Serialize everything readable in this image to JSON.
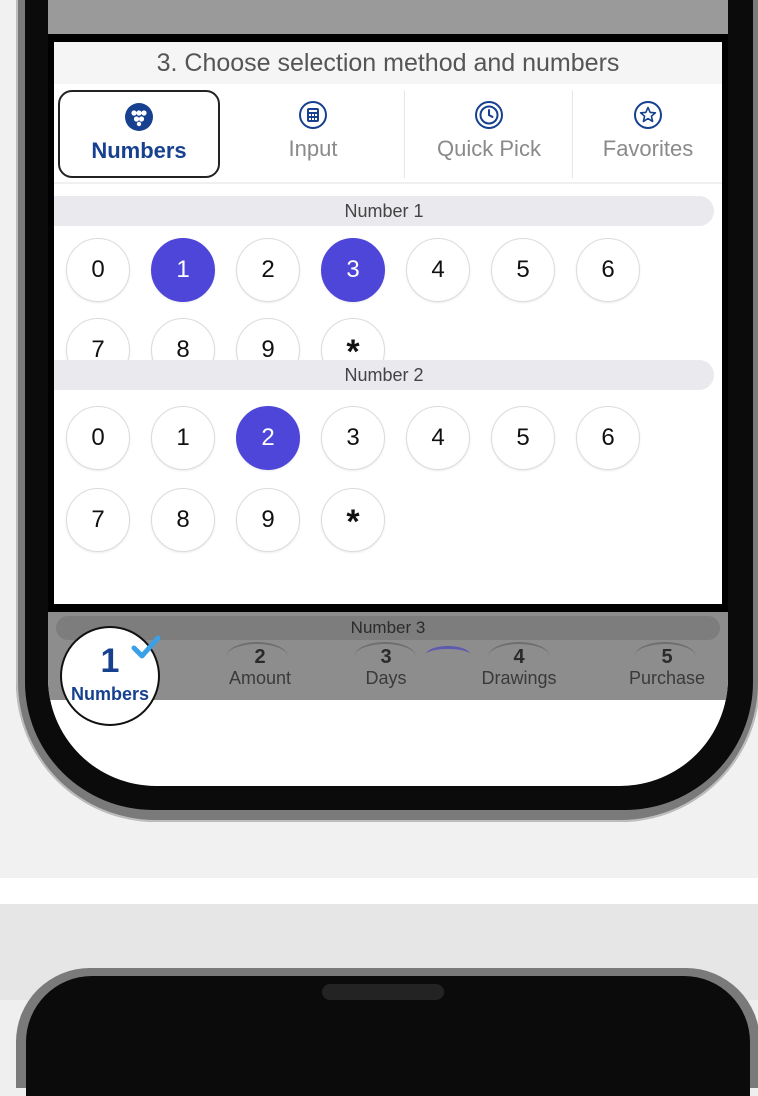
{
  "section": {
    "title": "3. Choose selection method and numbers"
  },
  "tabs": [
    {
      "label": "Numbers",
      "icon": "dots-grid-icon",
      "active": true
    },
    {
      "label": "Input",
      "icon": "keypad-icon",
      "active": false
    },
    {
      "label": "Quick Pick",
      "icon": "clock-icon",
      "active": false
    },
    {
      "label": "Favorites",
      "icon": "star-icon",
      "active": false
    }
  ],
  "number_groups": [
    {
      "label": "Number 1",
      "balls": [
        "0",
        "1",
        "2",
        "3",
        "4",
        "5",
        "6",
        "7",
        "8",
        "9",
        "*"
      ],
      "selected": [
        "1",
        "3"
      ]
    },
    {
      "label": "Number 2",
      "balls": [
        "0",
        "1",
        "2",
        "3",
        "4",
        "5",
        "6",
        "7",
        "8",
        "9",
        "*"
      ],
      "selected": [
        "2"
      ]
    }
  ],
  "overlay": {
    "number_3_label": "Number 3"
  },
  "steps": [
    {
      "num": "1",
      "label": "Numbers",
      "active": true
    },
    {
      "num": "2",
      "label": "Amount"
    },
    {
      "num": "3",
      "label": "Days"
    },
    {
      "num": "4",
      "label": "Drawings"
    },
    {
      "num": "5",
      "label": "Purchase"
    }
  ],
  "colors": {
    "accent": "#4e46d8",
    "brand": "#17408f",
    "check": "#3aa0e8"
  }
}
